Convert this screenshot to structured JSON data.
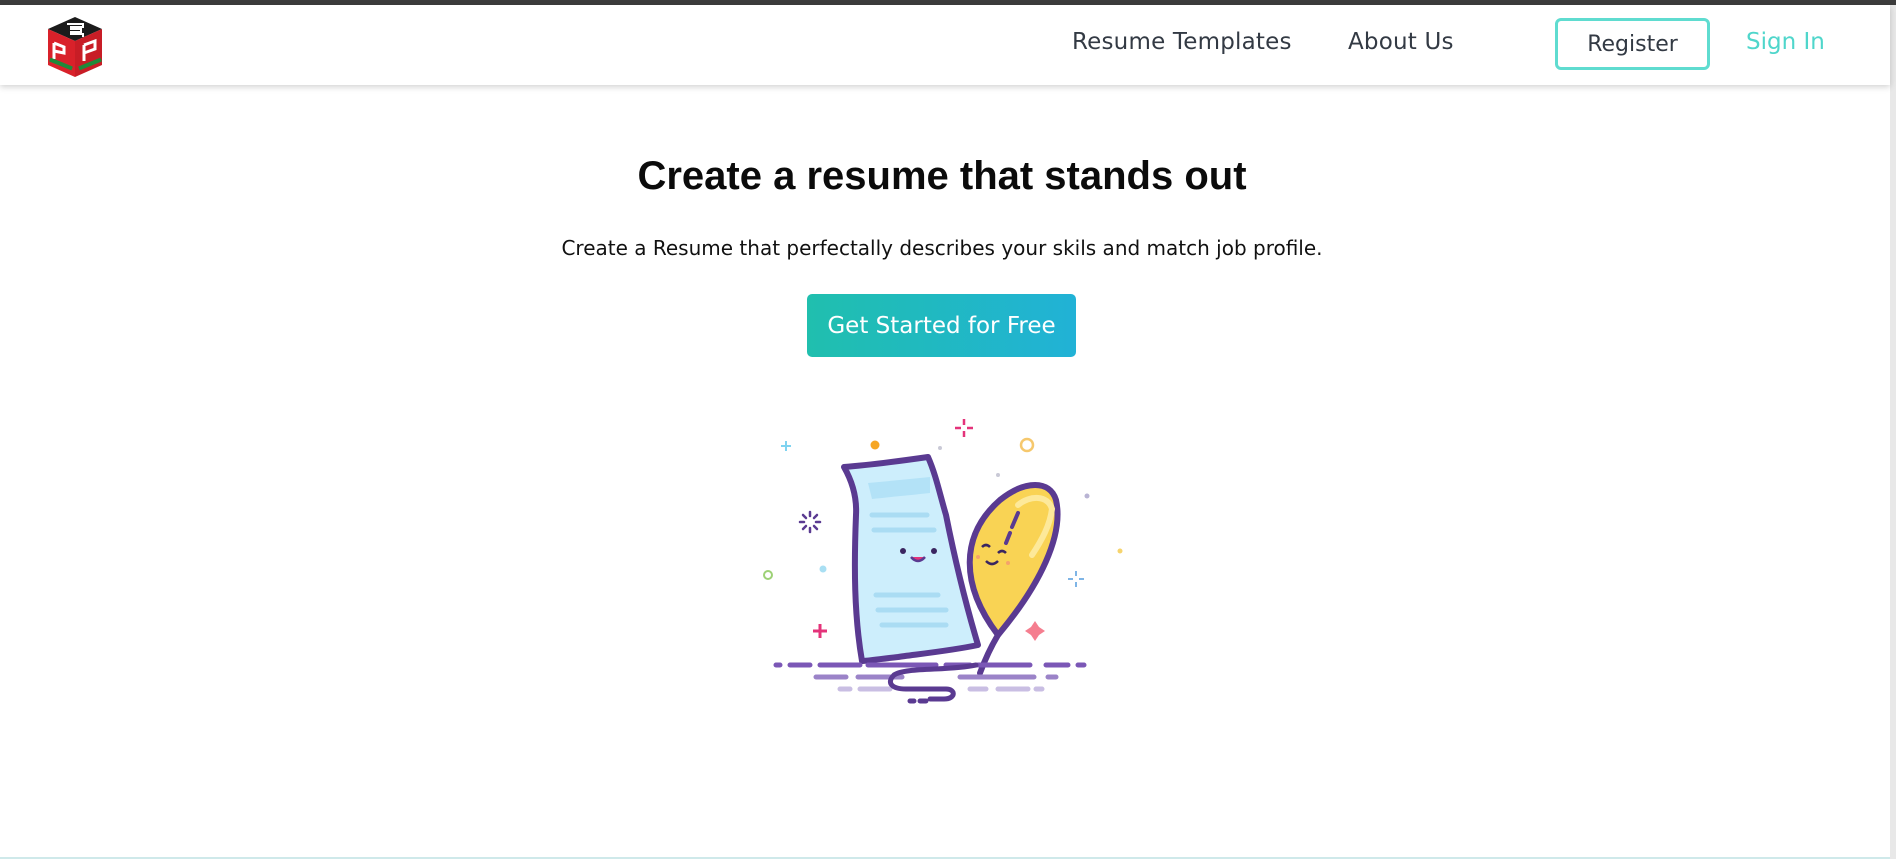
{
  "nav": {
    "logo_icon": "cube-logo-icon",
    "links": {
      "resume_templates": "Resume Templates",
      "about_us": "About Us"
    },
    "register_label": "Register",
    "signin_label": "Sign In"
  },
  "hero": {
    "title": "Create a resume that stands out",
    "subtitle": "Create a Resume that perfectally describes your skils and match job profile.",
    "cta_label": "Get Started for Free",
    "illustration_icon": "document-and-quill-icon"
  },
  "colors": {
    "accent_teal": "#4fd6cb",
    "cta_gradient_start": "#20bfae",
    "cta_gradient_end": "#21b2d6",
    "illustration_purple": "#5a3a91"
  }
}
